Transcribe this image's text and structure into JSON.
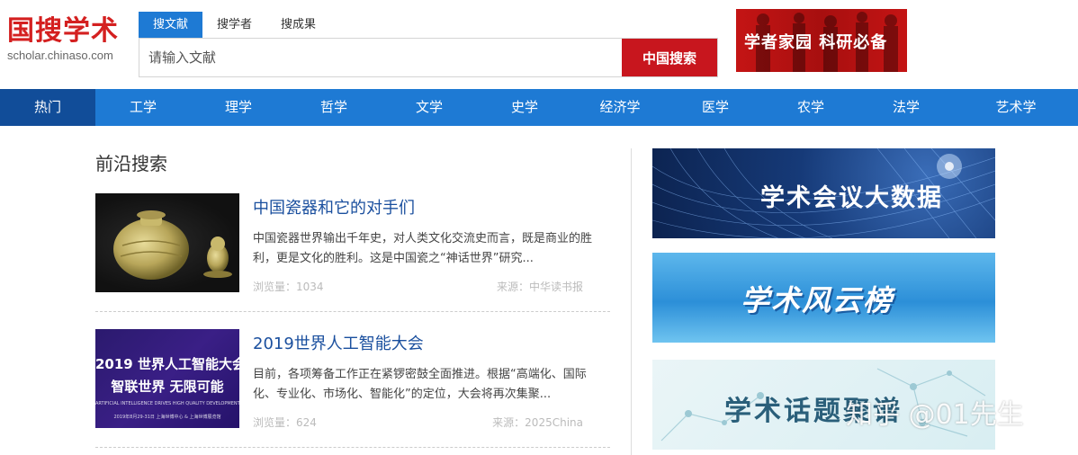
{
  "logo": {
    "main": "国搜学术",
    "sub": "scholar.chinaso.com"
  },
  "search": {
    "tabs": [
      {
        "label": "搜文献"
      },
      {
        "label": "搜学者"
      },
      {
        "label": "搜成果"
      }
    ],
    "active_tab": 0,
    "placeholder": "请输入文献",
    "button_label": "中国搜索"
  },
  "ad_banner": {
    "text": "学者家园 科研必备"
  },
  "nav": {
    "items": [
      "热门",
      "工学",
      "理学",
      "哲学",
      "文学",
      "史学",
      "经济学",
      "医学",
      "农学",
      "法学",
      "艺术学"
    ],
    "active_index": 0
  },
  "main": {
    "section_title": "前沿搜索",
    "articles": [
      {
        "title": "中国瓷器和它的对手们",
        "desc": "中国瓷器世界输出千年史，对人类文化交流史而言，既是商业的胜利，更是文化的胜利。这是中国瓷之“神话世界”研究...",
        "views": "浏览量：1034",
        "source": "来源：中华读书报"
      },
      {
        "title": "2019世界人工智能大会",
        "desc": "目前，各项筹备工作正在紧锣密鼓全面推进。根据“高端化、国际化、专业化、市场化、智能化”的定位，大会将再次集聚...",
        "views": "浏览量：624",
        "source": "来源：2025China",
        "thumb_lines": [
          "2019 世界人工智能大会",
          "智联世界 无限可能",
          "ARTIFICIAL INTELLIGENCE DRIVES HIGH QUALITY DEVELOPMENT",
          "2019年8月29-31日 上海世博中心 & 上海世博展览馆"
        ]
      }
    ]
  },
  "sidebar": {
    "banners": [
      {
        "text": "学术会议大数据"
      },
      {
        "text": "学术风云榜"
      },
      {
        "text": "学术话题聚谱"
      }
    ]
  },
  "watermark": "知乎 @01先生",
  "colors": {
    "brand_red": "#c8161e",
    "nav_blue": "#1e7ad4",
    "nav_active": "#114d99",
    "title_blue": "#1a4f9e"
  }
}
